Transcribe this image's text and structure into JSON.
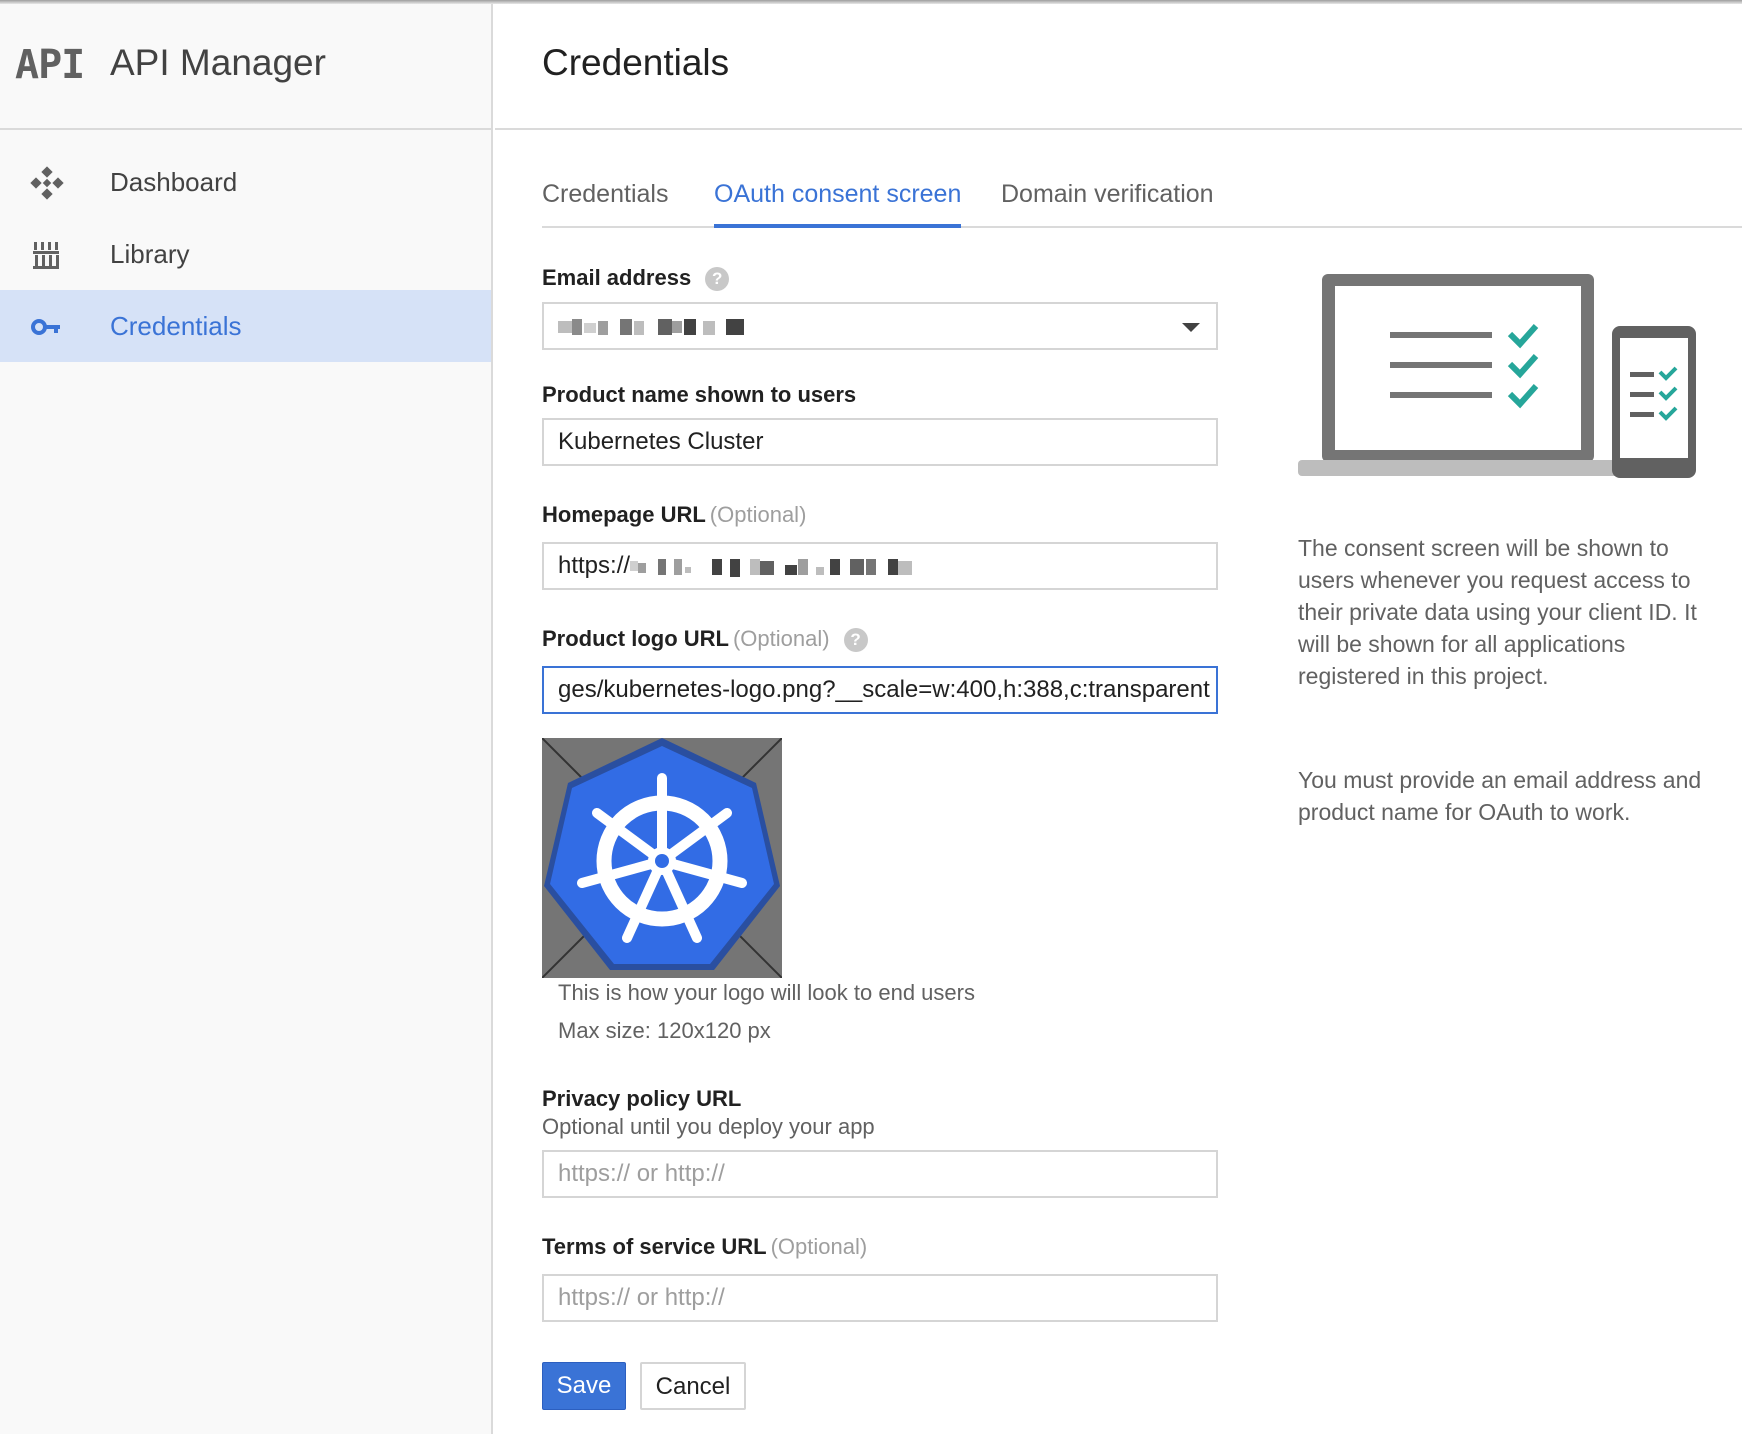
{
  "app": {
    "logo_text": "API",
    "title": "API Manager"
  },
  "sidebar": {
    "items": [
      {
        "label": "Dashboard",
        "icon": "dashboard-icon",
        "active": false
      },
      {
        "label": "Library",
        "icon": "library-icon",
        "active": false
      },
      {
        "label": "Credentials",
        "icon": "key-icon",
        "active": true
      }
    ]
  },
  "page": {
    "title": "Credentials"
  },
  "tabs": [
    {
      "label": "Credentials",
      "active": false
    },
    {
      "label": "OAuth consent screen",
      "active": true
    },
    {
      "label": "Domain verification",
      "active": false
    }
  ],
  "form": {
    "email": {
      "label": "Email address",
      "help_icon": "?",
      "value_redacted": true
    },
    "product_name": {
      "label": "Product name shown to users",
      "value": "Kubernetes Cluster"
    },
    "homepage": {
      "label": "Homepage URL",
      "optional": "(Optional)",
      "value_prefix": "https://",
      "value_redacted": true
    },
    "logo_url": {
      "label": "Product logo URL",
      "optional": "(Optional)",
      "help_icon": "?",
      "value": "ges/kubernetes-logo.png?__scale=w:400,h:388,c:transparent"
    },
    "logo_hint": "This is how your logo will look to end users",
    "logo_max": "Max size: 120x120 px",
    "privacy": {
      "label": "Privacy policy URL",
      "sublabel": "Optional until you deploy your app",
      "placeholder": "https:// or http://"
    },
    "terms": {
      "label": "Terms of service URL",
      "optional": "(Optional)",
      "placeholder": "https:// or http://"
    }
  },
  "buttons": {
    "save": "Save",
    "cancel": "Cancel"
  },
  "info": {
    "paragraph1": "The consent screen will be shown to users whenever you request access to their private data using your client ID. It will be shown for all applications registered in this project.",
    "paragraph2": "You must provide an email address and product name for OAuth to work."
  },
  "colors": {
    "accent": "#3a73d6",
    "sidebar_active_bg": "#d6e2f7",
    "check": "#26a69a",
    "logo_blue": "#326ce5"
  }
}
